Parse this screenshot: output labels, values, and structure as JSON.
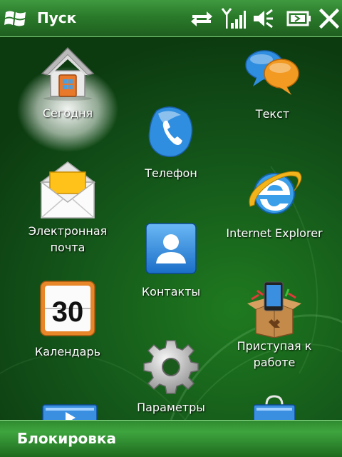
{
  "header": {
    "title": "Пуск",
    "start_icon": "windows-flag-icon",
    "status_icons": [
      "connectivity-arrows-icon",
      "signal-strength-icon",
      "speaker-mute-icon",
      "battery-icon",
      "close-icon"
    ]
  },
  "tiles": {
    "today": {
      "label": "Сегодня",
      "icon": "home-icon"
    },
    "text": {
      "label": "Текст",
      "icon": "speech-bubbles-icon"
    },
    "phone": {
      "label": "Телефон",
      "icon": "phone-icon"
    },
    "email": {
      "label": "Электронная\nпочта",
      "icon": "envelope-icon"
    },
    "ie": {
      "label": "Internet Explorer",
      "icon": "internet-explorer-icon"
    },
    "contacts": {
      "label": "Контакты",
      "icon": "contacts-icon"
    },
    "calendar": {
      "label": "Календарь",
      "icon": "calendar-icon",
      "day": "30"
    },
    "getting_started": {
      "label": "Приступая к\nработе",
      "icon": "getting-started-box-icon"
    },
    "settings": {
      "label": "Параметры",
      "icon": "gear-icon"
    }
  },
  "footer": {
    "softkey_label": "Блокировка"
  },
  "colors": {
    "accent": "#2a7a2a",
    "background": "#14561a"
  }
}
